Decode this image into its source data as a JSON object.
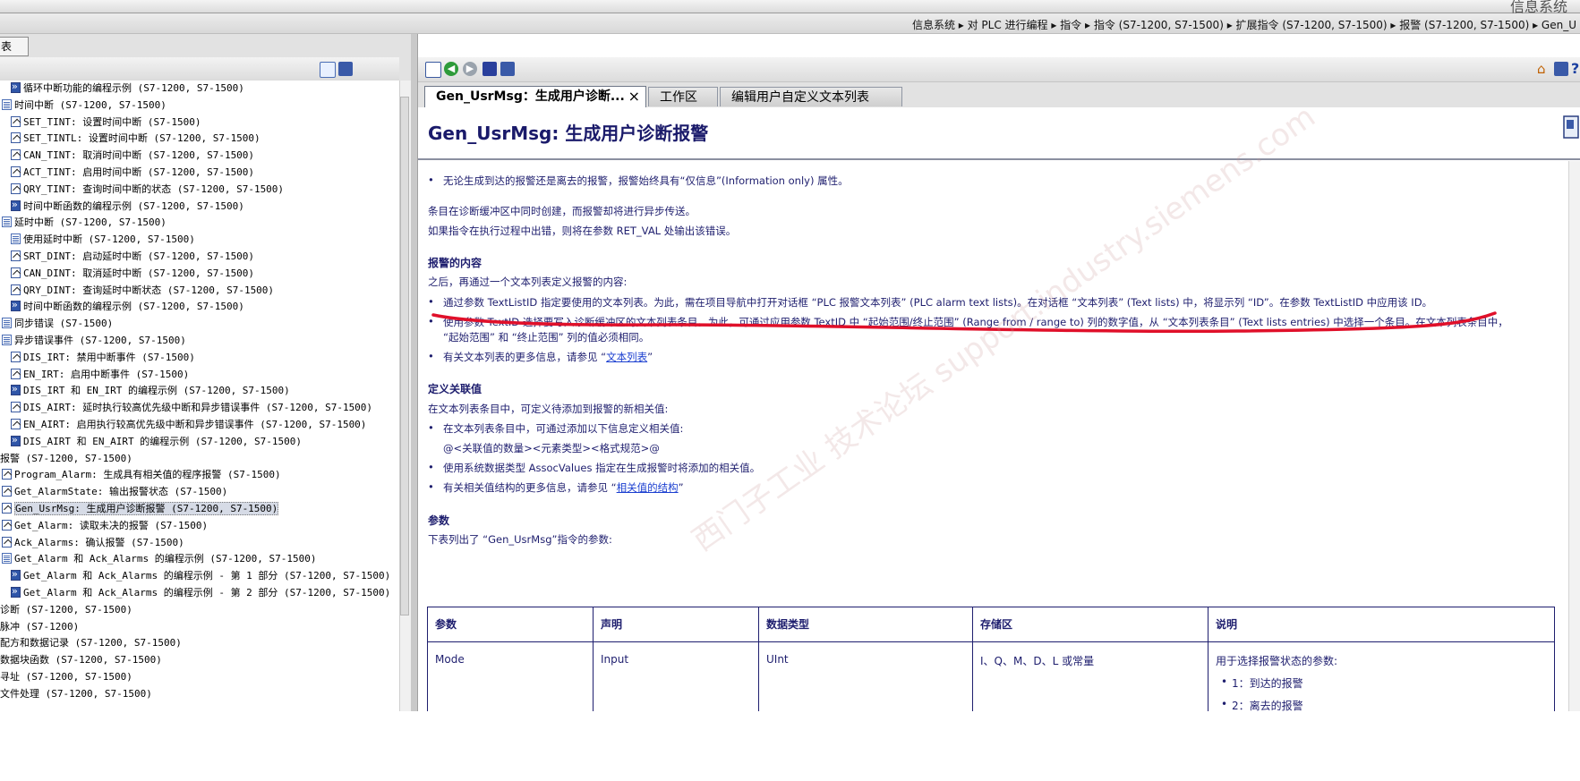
{
  "window": {
    "title": "信息系统",
    "breadcrumb": "信息系统 ▸ 对 PLC 进行编程 ▸ 指令 ▸ 指令 (S7-1200, S7-1500) ▸ 扩展指令 (S7-1200, S7-1500) ▸ 报警 (S7-1200, S7-1500) ▸ Gen_U"
  },
  "left_pane": {
    "tab_label": "表",
    "tree": [
      {
        "icon": "example-icon",
        "indent": 1,
        "label": "循环中断功能的编程示例 (S7-1200, S7-1500)"
      },
      {
        "icon": "book-icon",
        "indent": 0,
        "label": "时间中断 (S7-1200, S7-1500)"
      },
      {
        "icon": "doc-icon",
        "indent": 1,
        "label": "SET_TINT: 设置时间中断 (S7-1500)"
      },
      {
        "icon": "doc-icon",
        "indent": 1,
        "label": "SET_TINTL: 设置时间中断 (S7-1200, S7-1500)"
      },
      {
        "icon": "doc-icon",
        "indent": 1,
        "label": "CAN_TINT: 取消时间中断 (S7-1200, S7-1500)"
      },
      {
        "icon": "doc-icon",
        "indent": 1,
        "label": "ACT_TINT: 启用时间中断 (S7-1200, S7-1500)"
      },
      {
        "icon": "doc-icon",
        "indent": 1,
        "label": "QRY_TINT: 查询时间中断的状态 (S7-1200, S7-1500)"
      },
      {
        "icon": "example-icon",
        "indent": 1,
        "label": "时间中断函数的编程示例 (S7-1200, S7-1500)"
      },
      {
        "icon": "book-icon",
        "indent": 0,
        "label": "延时中断 (S7-1200, S7-1500)"
      },
      {
        "icon": "book-icon",
        "indent": 1,
        "label": "使用延时中断 (S7-1200, S7-1500)"
      },
      {
        "icon": "doc-icon",
        "indent": 1,
        "label": "SRT_DINT: 启动延时中断 (S7-1200, S7-1500)"
      },
      {
        "icon": "doc-icon",
        "indent": 1,
        "label": "CAN_DINT: 取消延时中断 (S7-1200, S7-1500)"
      },
      {
        "icon": "doc-icon",
        "indent": 1,
        "label": "QRY_DINT: 查询延时中断状态 (S7-1200, S7-1500)"
      },
      {
        "icon": "example-icon",
        "indent": 1,
        "label": "时间中断函数的编程示例 (S7-1200, S7-1500)"
      },
      {
        "icon": "book-icon",
        "indent": 0,
        "label": "同步错误 (S7-1500)"
      },
      {
        "icon": "book-icon",
        "indent": 0,
        "label": "异步错误事件 (S7-1200, S7-1500)"
      },
      {
        "icon": "doc-icon",
        "indent": 1,
        "label": "DIS_IRT: 禁用中断事件 (S7-1500)"
      },
      {
        "icon": "doc-icon",
        "indent": 1,
        "label": "EN_IRT: 启用中断事件 (S7-1500)"
      },
      {
        "icon": "example-icon",
        "indent": 1,
        "label": "DIS_IRT 和 EN_IRT 的编程示例 (S7-1200, S7-1500)"
      },
      {
        "icon": "doc-icon",
        "indent": 1,
        "label": "DIS_AIRT: 延时执行较高优先级中断和异步错误事件 (S7-1200, S7-1500)"
      },
      {
        "icon": "doc-icon",
        "indent": 1,
        "label": "EN_AIRT: 启用执行较高优先级中断和异步错误事件 (S7-1200, S7-1500)"
      },
      {
        "icon": "example-icon",
        "indent": 1,
        "label": "DIS_AIRT 和 EN_AIRT 的编程示例 (S7-1200, S7-1500)"
      },
      {
        "icon": "none",
        "indent": -1,
        "label": "报警 (S7-1200, S7-1500)"
      },
      {
        "icon": "doc-icon",
        "indent": 0,
        "label": "Program_Alarm: 生成具有相关值的程序报警 (S7-1500)"
      },
      {
        "icon": "doc-icon",
        "indent": 0,
        "label": "Get_AlarmState: 输出报警状态 (S7-1500)"
      },
      {
        "icon": "doc-icon",
        "indent": 0,
        "label": "Gen_UsrMsg: 生成用户诊断报警 (S7-1200, S7-1500)",
        "selected": true
      },
      {
        "icon": "doc-icon",
        "indent": 0,
        "label": "Get_Alarm: 读取未决的报警 (S7-1500)"
      },
      {
        "icon": "doc-icon",
        "indent": 0,
        "label": "Ack_Alarms: 确认报警 (S7-1500)"
      },
      {
        "icon": "book-icon",
        "indent": 0,
        "label": "Get_Alarm 和 Ack_Alarms 的编程示例 (S7-1200, S7-1500)"
      },
      {
        "icon": "example-icon",
        "indent": 1,
        "label": "Get_Alarm 和 Ack_Alarms 的编程示例 - 第 1 部分 (S7-1200, S7-1500)"
      },
      {
        "icon": "example-icon",
        "indent": 1,
        "label": "Get_Alarm 和 Ack_Alarms 的编程示例 - 第 2 部分 (S7-1200, S7-1500)"
      },
      {
        "icon": "none",
        "indent": -1,
        "label": "诊断 (S7-1200, S7-1500)"
      },
      {
        "icon": "none",
        "indent": -1,
        "label": "脉冲 (S7-1200)"
      },
      {
        "icon": "none",
        "indent": -1,
        "label": "配方和数据记录 (S7-1200, S7-1500)"
      },
      {
        "icon": "none",
        "indent": -1,
        "label": "数据块函数 (S7-1200, S7-1500)"
      },
      {
        "icon": "none",
        "indent": -1,
        "label": "寻址 (S7-1200, S7-1500)"
      },
      {
        "icon": "none",
        "indent": -1,
        "label": "文件处理 (S7-1200, S7-1500)"
      }
    ]
  },
  "right_pane": {
    "tabs": [
      {
        "label": "Gen_UsrMsg：生成用户诊断...",
        "active": true,
        "close": "×"
      },
      {
        "label": "工作区",
        "active": false
      },
      {
        "label": "编辑用户自定义文本列表",
        "active": false
      }
    ],
    "page_title": "Gen_UsrMsg:  生成用户诊断报警",
    "content": {
      "b1": "无论生成到达的报警还是离去的报警，报警始终具有“仅信息”(Information only) 属性。",
      "p1": "条目在诊断缓冲区中同时创建，而报警却将进行异步传送。",
      "p2": "如果指令在执行过程中出错，则将在参数 RET_VAL 处输出该错误。",
      "h1": "报警的内容",
      "p3": "之后，再通过一个文本列表定义报警的内容:",
      "b2": "通过参数 TextListID 指定要使用的文本列表。为此，需在项目导航中打开对话框 “PLC 报警文本列表” (PLC alarm text lists)。在对话框 “文本列表” (Text lists) 中，将显示列 “ID”。在参数 TextListID 中应用该 ID。",
      "b3a": "使用参数 TextID 选择要写入诊断缓冲区的文本列表条目。为此，可通过应用参数 TextID 中 “起始范围/终止范围” (Range from / range to) 列的数字值，从 “文本列表条目” (Text lists entries) 中选择一个条目。在文本列表条目中，",
      "b3b": "“起始范围” 和 “终止范围” 列的值必须相同。",
      "b4_pre": "有关文本列表的更多信息，请参见 “",
      "b4_link": "文本列表",
      "b4_post": "”",
      "h2": "定义关联值",
      "p4": "在文本列表条目中，可定义待添加到报警的新相关值:",
      "b5": "在文本列表条目中，可通过添加以下信息定义相关值:",
      "p5": "@<关联值的数量><元素类型><格式规范>@",
      "b6": "使用系统数据类型 AssocValues 指定在生成报警时将添加的相关值。",
      "b7_pre": "有关相关值结构的更多信息，请参见 “",
      "b7_link": "相关值的结构",
      "b7_post": "”",
      "h3": "参数",
      "p6": "下表列出了 “Gen_UsrMsg”指令的参数:"
    },
    "params_table": {
      "headers": [
        "参数",
        "声明",
        "数据类型",
        "存储区",
        "说明"
      ],
      "rows": [
        {
          "param": "Mode",
          "decl": "Input",
          "type": "UInt",
          "area": "I、Q、M、D、L 或常量",
          "desc": "用于选择报警状态的参数:",
          "desc_items": [
            "1：到达的报警",
            "2：离去的报警"
          ]
        }
      ]
    },
    "watermark": "西门子工业 技术论坛 support.industry.siemens.com"
  },
  "colors": {
    "accent_red": "#e0102a",
    "link": "#1b3fd0",
    "text_blue": "#1e1e6e"
  }
}
